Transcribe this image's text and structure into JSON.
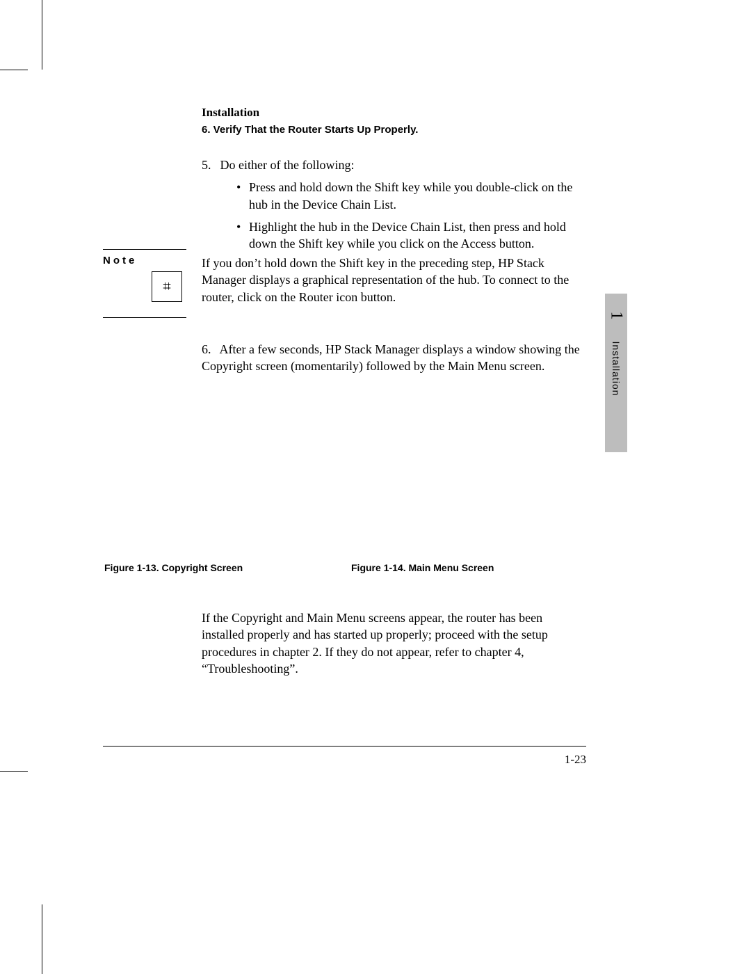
{
  "header": {
    "section": "Installation",
    "subsection": "6. Verify That the Router Starts Up Properly."
  },
  "step5": {
    "number": "5.",
    "intro": "Do either of the following:",
    "bullets": [
      "Press and hold down the Shift key while you double-click on the hub in the Device Chain List.",
      "Highlight the hub in the Device Chain List, then press and hold down the Shift key while you click on the Access button."
    ]
  },
  "note": {
    "label": "Note",
    "icon_name": "network-hub-icon",
    "icon_glyph": "⌗",
    "text": "If you don’t hold down the Shift key in the preceding step, HP Stack Manager displays a graphical representation of the hub. To connect to the router, click on the Router icon button."
  },
  "step6": {
    "number": "6.",
    "text": "After a few seconds, HP Stack Manager displays a window showing the Copyright screen (momentarily) followed by the Main Menu screen."
  },
  "figures": {
    "left": "Figure 1-13. Copyright Screen",
    "right": "Figure 1-14. Main Menu Screen"
  },
  "closing": "If the Copyright and Main Menu screens appear, the router has been installed properly and has started up properly; proceed with the setup procedures in chapter 2. If they do not appear, refer to chapter 4, “Troubleshooting”.",
  "page_number": "1-23",
  "sidetab": {
    "chapter": "1",
    "title": "Installation"
  }
}
